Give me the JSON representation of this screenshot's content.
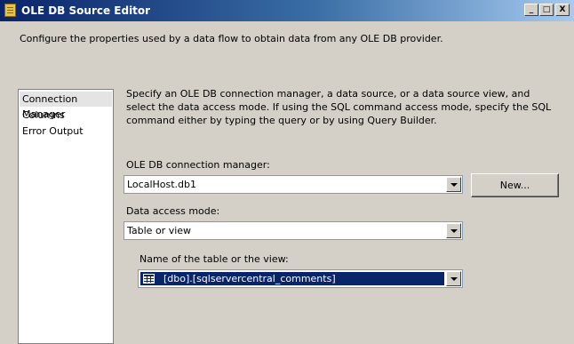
{
  "window": {
    "title": "OLE DB Source Editor",
    "buttons": {
      "minimize": "_",
      "maximize": "□",
      "close": "X"
    }
  },
  "header": {
    "description": "Configure the properties used by a data flow to obtain data from any OLE DB provider."
  },
  "nav": {
    "items": [
      {
        "label": "Connection Manager",
        "selected": true
      },
      {
        "label": "Columns",
        "selected": false
      },
      {
        "label": "Error Output",
        "selected": false
      }
    ]
  },
  "page": {
    "description": "Specify an OLE DB connection manager, a data source, or a data source view, and select the data access mode. If using the SQL command access mode, specify the SQL command either by typing the query or by using Query Builder.",
    "connection_manager": {
      "label": "OLE DB connection manager:",
      "value": "LocalHost.db1",
      "new_button": "New..."
    },
    "data_access_mode": {
      "label": "Data access mode:",
      "value": "Table or view"
    },
    "table_name": {
      "label": "Name of the table or the view:",
      "value": "[dbo].[sqlservercentral_comments]"
    }
  },
  "icons": {
    "app": "package-icon",
    "table": "table-icon",
    "dropdown": "chevron-down-icon"
  }
}
